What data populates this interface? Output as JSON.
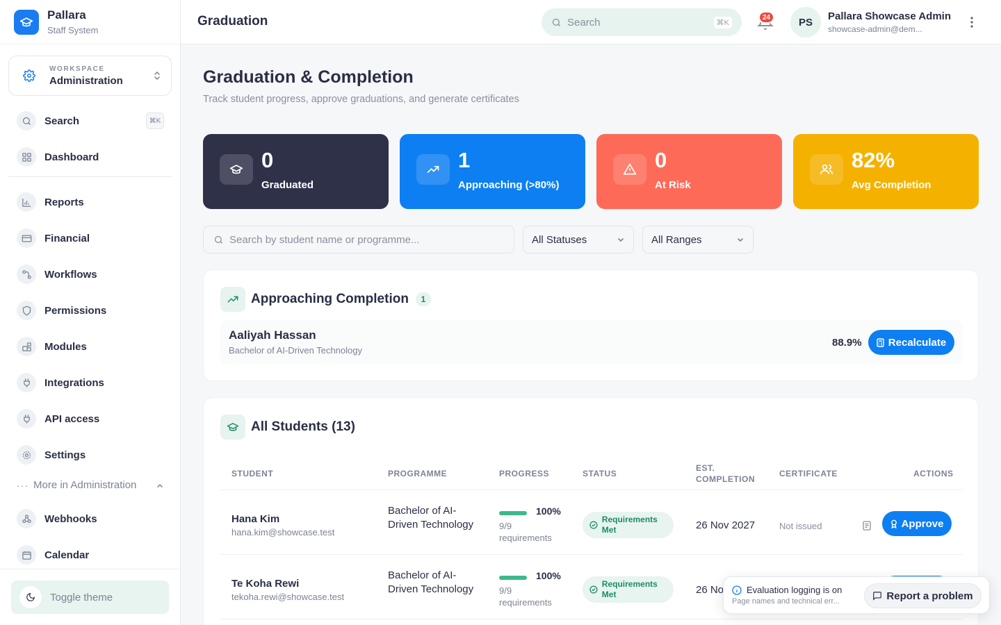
{
  "brand": {
    "name": "Pallara",
    "subtitle": "Staff System"
  },
  "workspace": {
    "label": "WORKSPACE",
    "value": "Administration"
  },
  "sidebar": {
    "items": [
      {
        "label": "Search",
        "icon": "search-icon",
        "shortcut": "⌘K"
      },
      {
        "label": "Dashboard",
        "icon": "dashboard-icon"
      },
      {
        "label": "Reports",
        "icon": "bar-chart-icon"
      },
      {
        "label": "Financial",
        "icon": "credit-card-icon"
      },
      {
        "label": "Workflows",
        "icon": "workflow-icon"
      },
      {
        "label": "Permissions",
        "icon": "shield-icon"
      },
      {
        "label": "Modules",
        "icon": "modules-icon"
      },
      {
        "label": "Integrations",
        "icon": "plug-icon"
      },
      {
        "label": "API access",
        "icon": "plug-icon"
      },
      {
        "label": "Settings",
        "icon": "gear-icon"
      }
    ],
    "more_label": "More in Administration",
    "more_items": [
      {
        "label": "Webhooks",
        "icon": "webhook-icon"
      },
      {
        "label": "Calendar",
        "icon": "calendar-icon"
      }
    ],
    "toggle_theme": "Toggle theme"
  },
  "header": {
    "title": "Graduation",
    "search_placeholder": "Search",
    "search_shortcut": "⌘K",
    "notification_count": "24",
    "avatar_initials": "PS",
    "user_name": "Pallara Showcase Admin",
    "user_email": "showcase-admin@dem..."
  },
  "page": {
    "title": "Graduation & Completion",
    "subtitle": "Track student progress, approve graduations, and generate certificates"
  },
  "stats": [
    {
      "value": "0",
      "label": "Graduated",
      "icon": "graduation-cap-icon",
      "color": "#2f3149"
    },
    {
      "value": "1",
      "label": "Approaching (>80%)",
      "icon": "trending-up-icon",
      "color": "#0d7ff2"
    },
    {
      "value": "0",
      "label": "At Risk",
      "icon": "warning-icon",
      "color": "#fd6b58"
    },
    {
      "value": "82%",
      "label": "Avg Completion",
      "icon": "users-icon",
      "color": "#f5b100"
    }
  ],
  "filters": {
    "search_placeholder": "Search by student name or programme...",
    "status_value": "All Statuses",
    "range_value": "All Ranges"
  },
  "approaching": {
    "title": "Approaching Completion",
    "count": "1",
    "rows": [
      {
        "name": "Aaliyah Hassan",
        "programme": "Bachelor of AI-Driven Technology",
        "percent": "88.9%",
        "action": "Recalculate"
      }
    ]
  },
  "all_students": {
    "title": "All Students (13)",
    "columns": {
      "student": "STUDENT",
      "programme": "PROGRAMME",
      "progress": "PROGRESS",
      "status": "STATUS",
      "est_completion_1": "EST.",
      "est_completion_2": "COMPLETION",
      "certificate": "CERTIFICATE",
      "actions": "ACTIONS"
    },
    "rows": [
      {
        "name": "Hana Kim",
        "email": "hana.kim@showcase.test",
        "programme": "Bachelor of AI-Driven Technology",
        "progress": 1.0,
        "progress_label": "100%",
        "requirements": "9/9 requirements",
        "status": "Requirements Met",
        "est_completion": "26 Nov 2027",
        "certificate": "Not issued",
        "action": "Approve"
      },
      {
        "name": "Te Koha Rewi",
        "email": "tekoha.rewi@showcase.test",
        "programme": "Bachelor of AI-Driven Technology",
        "progress": 1.0,
        "progress_label": "100%",
        "requirements": "9/9 requirements",
        "status": "Requirements Met",
        "est_completion": "26 No"
      }
    ]
  },
  "toast": {
    "title": "Evaluation logging is on",
    "subtitle": "Page names and technical err...",
    "button": "Report a problem"
  }
}
